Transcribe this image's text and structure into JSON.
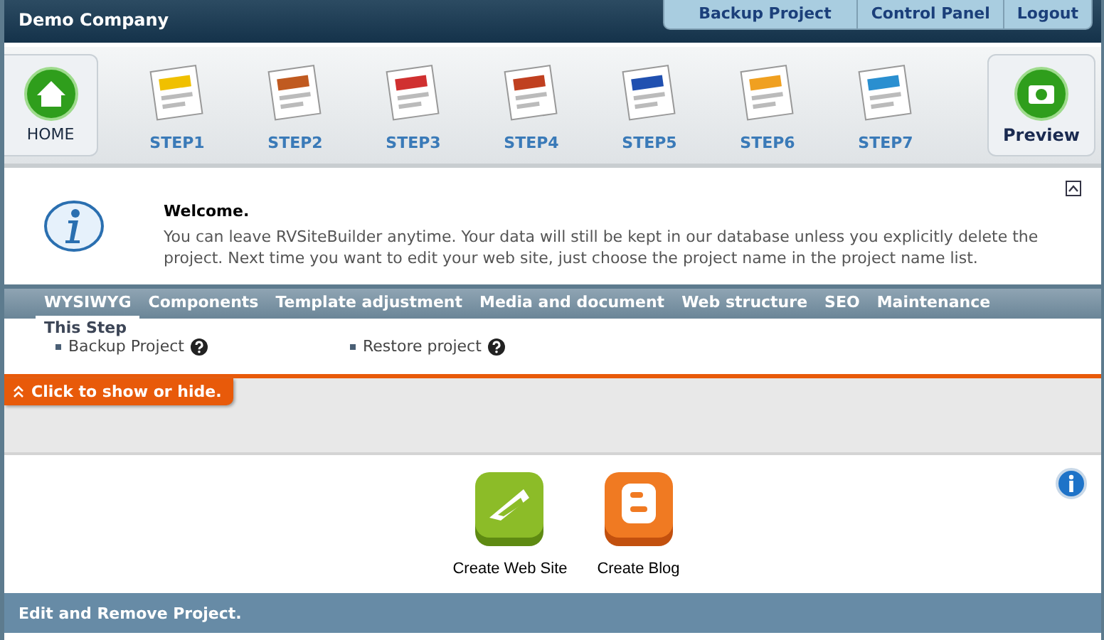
{
  "header": {
    "company": "Demo Company",
    "links": [
      "Backup Project",
      "Control Panel",
      "Logout"
    ]
  },
  "home": {
    "label": "HOME"
  },
  "steps": [
    {
      "label": "STEP1"
    },
    {
      "label": "STEP2"
    },
    {
      "label": "STEP3"
    },
    {
      "label": "STEP4"
    },
    {
      "label": "STEP5"
    },
    {
      "label": "STEP6"
    },
    {
      "label": "STEP7"
    }
  ],
  "preview": {
    "label": "Preview"
  },
  "welcome": {
    "title": "Welcome.",
    "text": "You can leave RVSiteBuilder anytime. Your data will still be kept in our database unless you explicitly delete the project. Next time you want to edit your web site, just choose the project name in the project name list."
  },
  "tabs": [
    {
      "label": "WYSIWYG",
      "selected": true
    },
    {
      "label": "Components",
      "selected": false
    },
    {
      "label": "Template adjustment",
      "selected": false
    },
    {
      "label": "Media and document",
      "selected": false
    },
    {
      "label": "Web structure",
      "selected": false
    },
    {
      "label": "SEO",
      "selected": false
    },
    {
      "label": "Maintenance",
      "selected": false
    }
  ],
  "this_step": {
    "title": "This Step",
    "items": [
      "Backup Project",
      "Restore project"
    ]
  },
  "toggle": {
    "label": "Click to show or hide."
  },
  "actions": [
    {
      "label": "Create Web Site",
      "kind": "site"
    },
    {
      "label": "Create Blog",
      "kind": "blog"
    }
  ],
  "section": {
    "title": "Edit and Remove Project."
  }
}
